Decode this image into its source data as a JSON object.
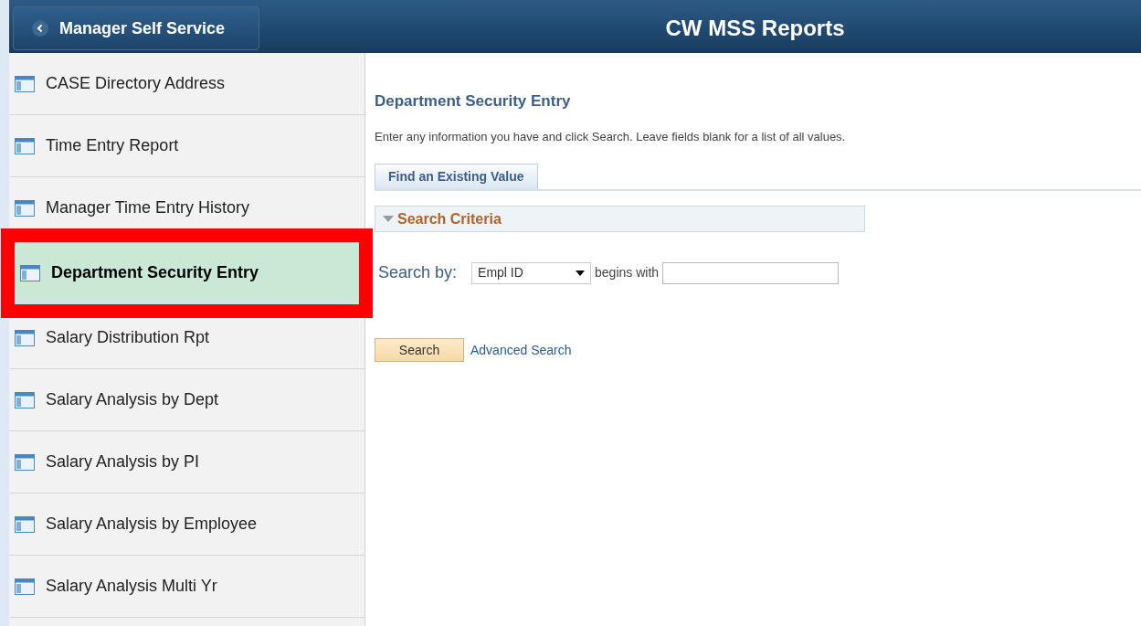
{
  "header": {
    "back_button": "Manager Self Service",
    "title": "CW MSS Reports"
  },
  "sidebar": {
    "items": [
      {
        "label": "CASE Directory Address",
        "selected": false
      },
      {
        "label": "Time Entry Report",
        "selected": false
      },
      {
        "label": "Manager Time Entry History",
        "selected": false
      },
      {
        "label": "Department Security Entry",
        "selected": true
      },
      {
        "label": "Salary Distribution Rpt",
        "selected": false
      },
      {
        "label": "Salary Analysis by Dept",
        "selected": false
      },
      {
        "label": "Salary Analysis by PI",
        "selected": false
      },
      {
        "label": "Salary Analysis by Employee",
        "selected": false
      },
      {
        "label": "Salary Analysis Multi Yr",
        "selected": false
      }
    ]
  },
  "main": {
    "title": "Department Security Entry",
    "instructions": "Enter any information you have and click Search. Leave fields blank for a list of all values.",
    "tabs": [
      {
        "label": "Find an Existing Value",
        "selected": true
      }
    ],
    "section": {
      "title": "Search Criteria",
      "expanded": true
    },
    "search_by": {
      "label": "Search by:",
      "field": "Empl ID",
      "operator": "begins with"
    },
    "buttons": {
      "search": "Search",
      "advanced": "Advanced Search"
    }
  }
}
